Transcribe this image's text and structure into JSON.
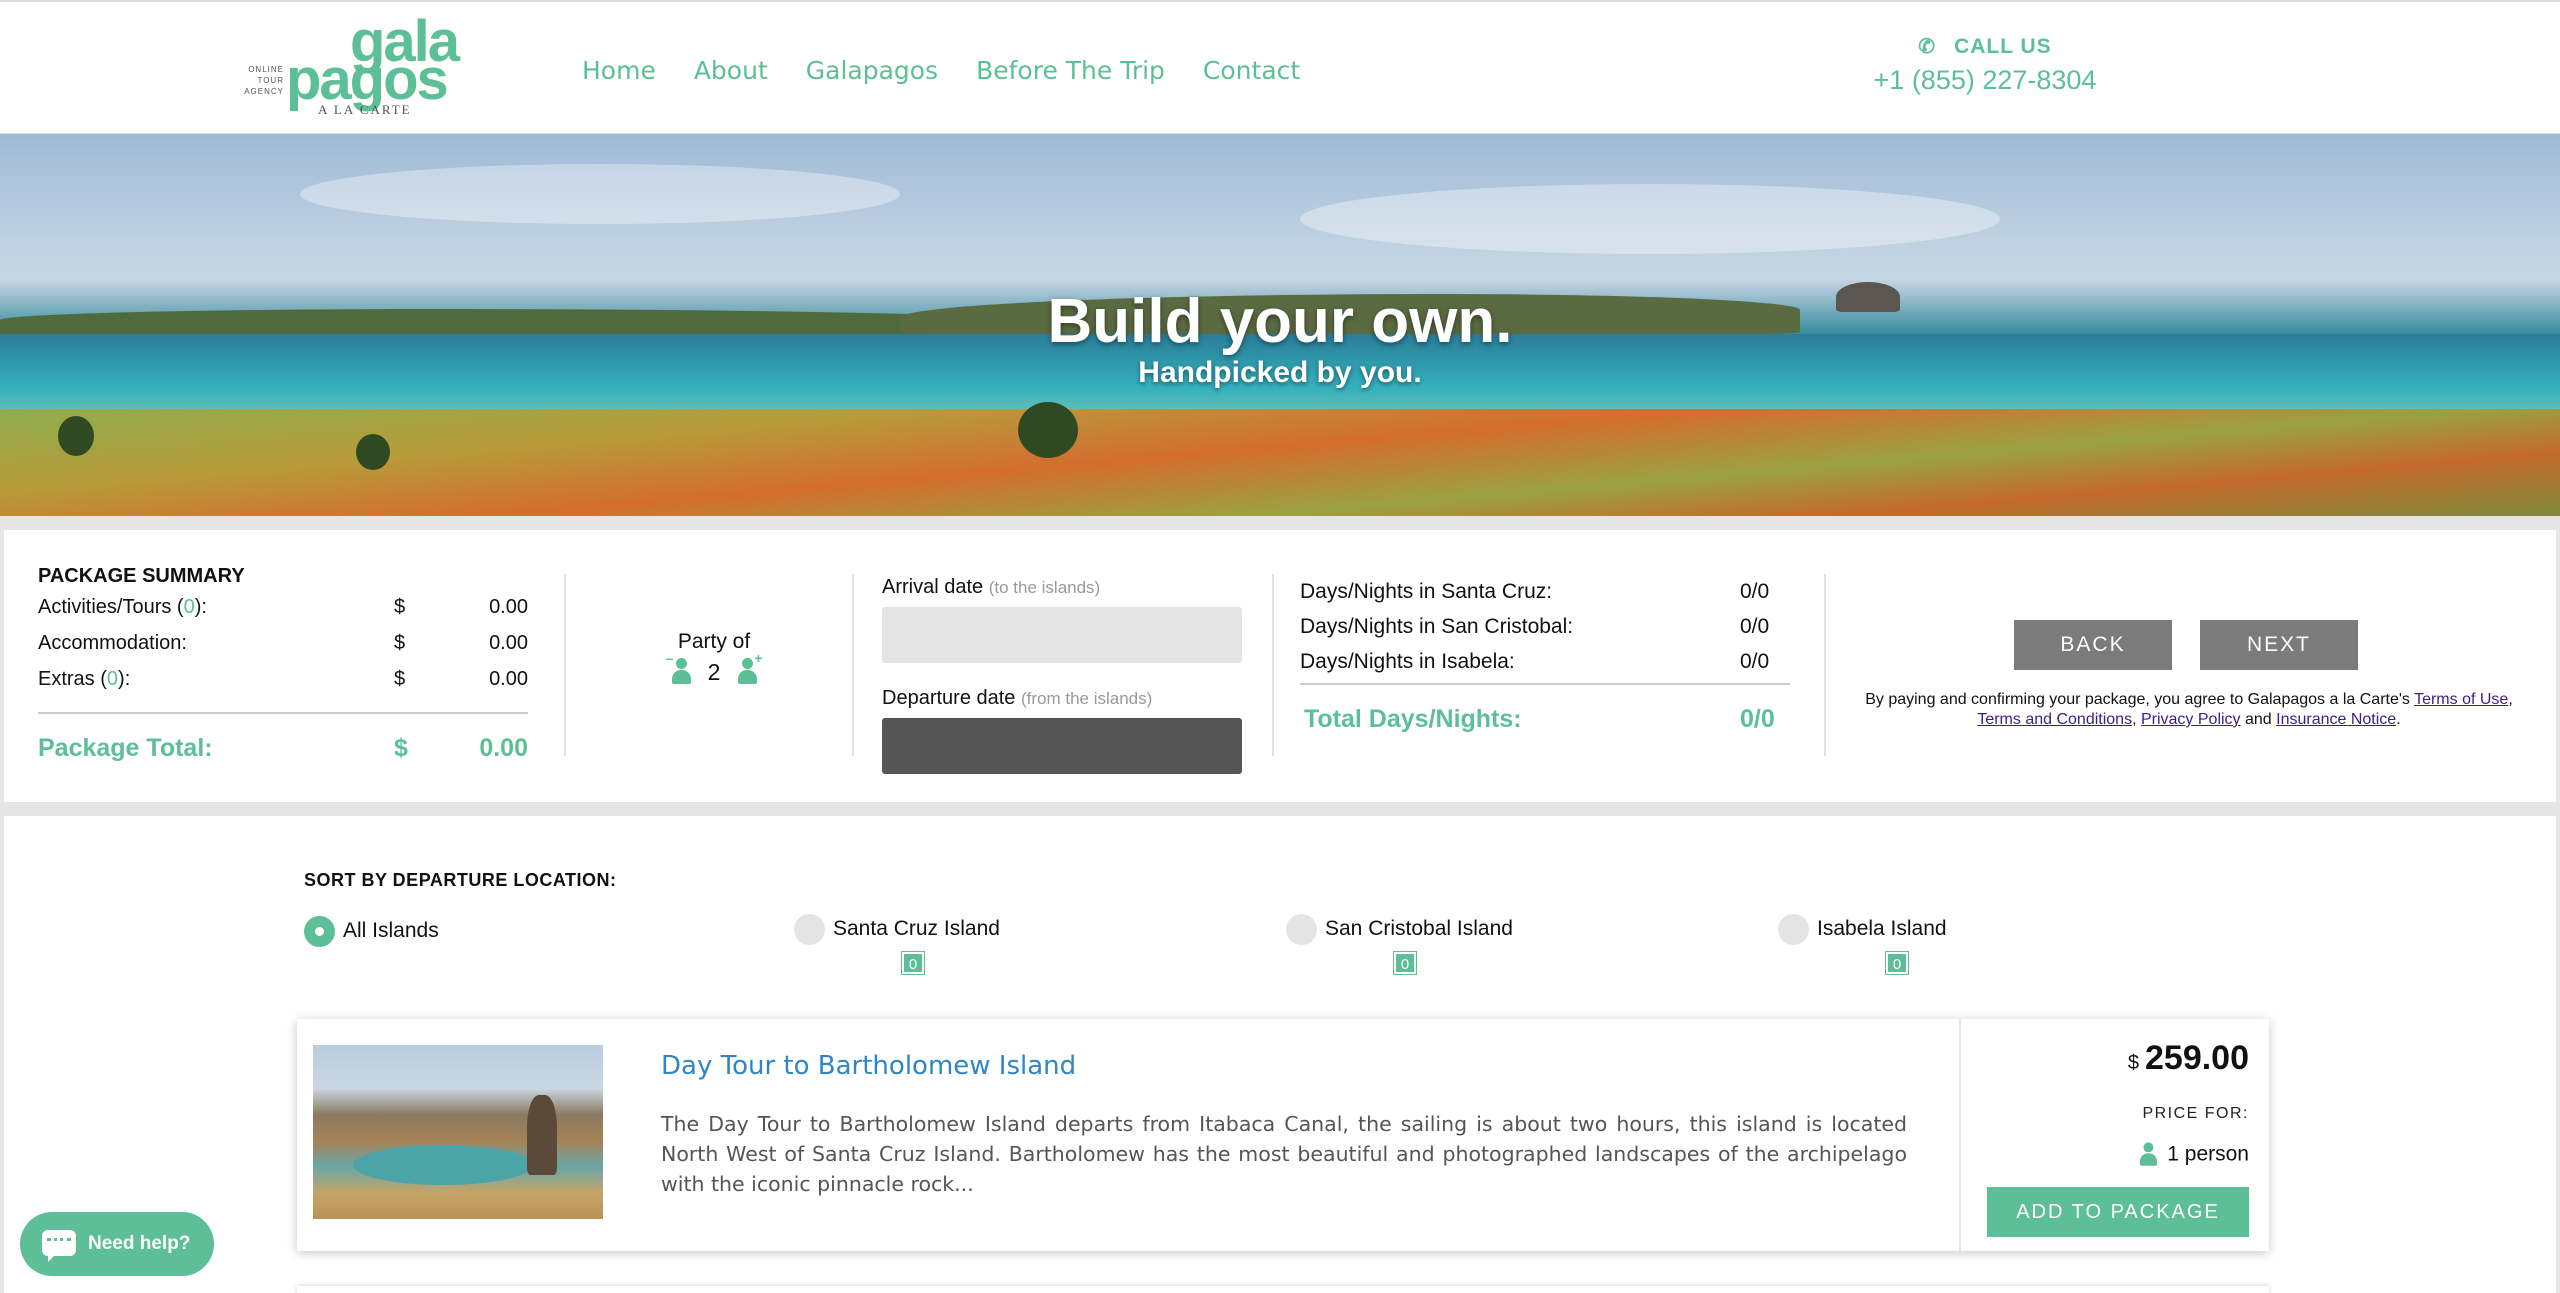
{
  "header": {
    "logo": {
      "small": "ONLINE TOUR AGENCY",
      "gala": "gala",
      "pagos": "pagos",
      "alacarte": "A LA CARTE"
    },
    "nav": [
      "Home",
      "About",
      "Galapagos",
      "Before The Trip",
      "Contact"
    ],
    "call_label": "CALL US",
    "phone": "+1 (855) 227-8304",
    "icon": "phone-icon",
    "accent_color": "#5cbf98"
  },
  "hero": {
    "title": "Build your own.",
    "subtitle": "Handpicked by you."
  },
  "summary": {
    "title": "PACKAGE SUMMARY",
    "rows": [
      {
        "label_pre": "Activities/Tours (",
        "count": "0",
        "label_post": "):",
        "currency": "$",
        "value": "0.00"
      },
      {
        "label_pre": "Accommodation:",
        "count": "",
        "label_post": "",
        "currency": "$",
        "value": "0.00"
      },
      {
        "label_pre": "Extras (",
        "count": "0",
        "label_post": "):",
        "currency": "$",
        "value": "0.00"
      }
    ],
    "total_label": "Package Total:",
    "total_currency": "$",
    "total_value": "0.00",
    "party_label": "Party of",
    "party_count": "2",
    "arrival_label": "Arrival date",
    "arrival_hint": "(to the islands)",
    "departure_label": "Departure date",
    "departure_hint": "(from the islands)",
    "days": [
      {
        "label": "Days/Nights in Santa Cruz:",
        "value": "0/0"
      },
      {
        "label": "Days/Nights in San Cristobal:",
        "value": "0/0"
      },
      {
        "label": "Days/Nights in Isabela:",
        "value": "0/0"
      }
    ],
    "days_total_label": "Total Days/Nights:",
    "days_total_value": "0/0",
    "back_label": "BACK",
    "next_label": "NEXT",
    "terms_pre": "By paying and confirming your package, you agree to Galapagos a la Carte's ",
    "terms_link1": "Terms of Use",
    "terms_sep1": ", ",
    "terms_link2": "Terms and Conditions",
    "terms_sep2": ", ",
    "terms_link3": "Privacy Policy",
    "terms_sep3": " and ",
    "terms_link4": "Insurance Notice",
    "terms_end": "."
  },
  "listing": {
    "sort_label": "SORT BY DEPARTURE LOCATION:",
    "options": [
      {
        "label": "All Islands",
        "selected": true,
        "count": ""
      },
      {
        "label": "Santa Cruz Island",
        "selected": false,
        "count": "0"
      },
      {
        "label": "San Cristobal Island",
        "selected": false,
        "count": "0"
      },
      {
        "label": "Isabela Island",
        "selected": false,
        "count": "0"
      }
    ],
    "card": {
      "title": "Day Tour to Bartholomew Island",
      "description": "The Day Tour to Bartholomew Island departs from Itabaca Canal, the sailing is about two hours, this island is located North West of Santa Cruz Island. Bartholomew has the most beautiful and photographed landscapes of the archipelago with the iconic pinnacle rock...",
      "currency": "$",
      "price": "259.00",
      "price_for": "PRICE FOR:",
      "people": "1 person",
      "add_label": "ADD TO PACKAGE"
    }
  },
  "help": {
    "label": "Need help?"
  }
}
